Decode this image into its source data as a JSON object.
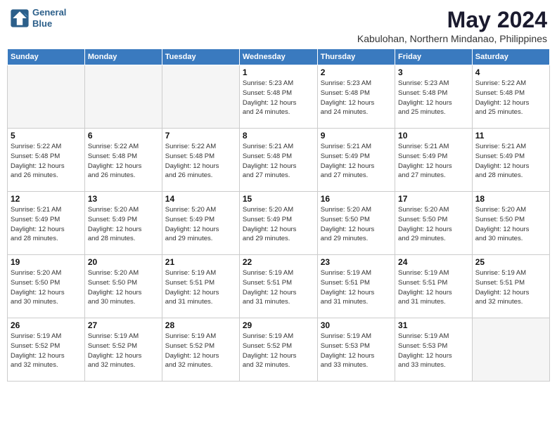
{
  "header": {
    "logo_line1": "General",
    "logo_line2": "Blue",
    "month": "May 2024",
    "location": "Kabulohan, Northern Mindanao, Philippines"
  },
  "weekdays": [
    "Sunday",
    "Monday",
    "Tuesday",
    "Wednesday",
    "Thursday",
    "Friday",
    "Saturday"
  ],
  "weeks": [
    [
      {
        "day": "",
        "info": ""
      },
      {
        "day": "",
        "info": ""
      },
      {
        "day": "",
        "info": ""
      },
      {
        "day": "1",
        "info": "Sunrise: 5:23 AM\nSunset: 5:48 PM\nDaylight: 12 hours\nand 24 minutes."
      },
      {
        "day": "2",
        "info": "Sunrise: 5:23 AM\nSunset: 5:48 PM\nDaylight: 12 hours\nand 24 minutes."
      },
      {
        "day": "3",
        "info": "Sunrise: 5:23 AM\nSunset: 5:48 PM\nDaylight: 12 hours\nand 25 minutes."
      },
      {
        "day": "4",
        "info": "Sunrise: 5:22 AM\nSunset: 5:48 PM\nDaylight: 12 hours\nand 25 minutes."
      }
    ],
    [
      {
        "day": "5",
        "info": "Sunrise: 5:22 AM\nSunset: 5:48 PM\nDaylight: 12 hours\nand 26 minutes."
      },
      {
        "day": "6",
        "info": "Sunrise: 5:22 AM\nSunset: 5:48 PM\nDaylight: 12 hours\nand 26 minutes."
      },
      {
        "day": "7",
        "info": "Sunrise: 5:22 AM\nSunset: 5:48 PM\nDaylight: 12 hours\nand 26 minutes."
      },
      {
        "day": "8",
        "info": "Sunrise: 5:21 AM\nSunset: 5:48 PM\nDaylight: 12 hours\nand 27 minutes."
      },
      {
        "day": "9",
        "info": "Sunrise: 5:21 AM\nSunset: 5:49 PM\nDaylight: 12 hours\nand 27 minutes."
      },
      {
        "day": "10",
        "info": "Sunrise: 5:21 AM\nSunset: 5:49 PM\nDaylight: 12 hours\nand 27 minutes."
      },
      {
        "day": "11",
        "info": "Sunrise: 5:21 AM\nSunset: 5:49 PM\nDaylight: 12 hours\nand 28 minutes."
      }
    ],
    [
      {
        "day": "12",
        "info": "Sunrise: 5:21 AM\nSunset: 5:49 PM\nDaylight: 12 hours\nand 28 minutes."
      },
      {
        "day": "13",
        "info": "Sunrise: 5:20 AM\nSunset: 5:49 PM\nDaylight: 12 hours\nand 28 minutes."
      },
      {
        "day": "14",
        "info": "Sunrise: 5:20 AM\nSunset: 5:49 PM\nDaylight: 12 hours\nand 29 minutes."
      },
      {
        "day": "15",
        "info": "Sunrise: 5:20 AM\nSunset: 5:49 PM\nDaylight: 12 hours\nand 29 minutes."
      },
      {
        "day": "16",
        "info": "Sunrise: 5:20 AM\nSunset: 5:50 PM\nDaylight: 12 hours\nand 29 minutes."
      },
      {
        "day": "17",
        "info": "Sunrise: 5:20 AM\nSunset: 5:50 PM\nDaylight: 12 hours\nand 29 minutes."
      },
      {
        "day": "18",
        "info": "Sunrise: 5:20 AM\nSunset: 5:50 PM\nDaylight: 12 hours\nand 30 minutes."
      }
    ],
    [
      {
        "day": "19",
        "info": "Sunrise: 5:20 AM\nSunset: 5:50 PM\nDaylight: 12 hours\nand 30 minutes."
      },
      {
        "day": "20",
        "info": "Sunrise: 5:20 AM\nSunset: 5:50 PM\nDaylight: 12 hours\nand 30 minutes."
      },
      {
        "day": "21",
        "info": "Sunrise: 5:19 AM\nSunset: 5:51 PM\nDaylight: 12 hours\nand 31 minutes."
      },
      {
        "day": "22",
        "info": "Sunrise: 5:19 AM\nSunset: 5:51 PM\nDaylight: 12 hours\nand 31 minutes."
      },
      {
        "day": "23",
        "info": "Sunrise: 5:19 AM\nSunset: 5:51 PM\nDaylight: 12 hours\nand 31 minutes."
      },
      {
        "day": "24",
        "info": "Sunrise: 5:19 AM\nSunset: 5:51 PM\nDaylight: 12 hours\nand 31 minutes."
      },
      {
        "day": "25",
        "info": "Sunrise: 5:19 AM\nSunset: 5:51 PM\nDaylight: 12 hours\nand 32 minutes."
      }
    ],
    [
      {
        "day": "26",
        "info": "Sunrise: 5:19 AM\nSunset: 5:52 PM\nDaylight: 12 hours\nand 32 minutes."
      },
      {
        "day": "27",
        "info": "Sunrise: 5:19 AM\nSunset: 5:52 PM\nDaylight: 12 hours\nand 32 minutes."
      },
      {
        "day": "28",
        "info": "Sunrise: 5:19 AM\nSunset: 5:52 PM\nDaylight: 12 hours\nand 32 minutes."
      },
      {
        "day": "29",
        "info": "Sunrise: 5:19 AM\nSunset: 5:52 PM\nDaylight: 12 hours\nand 32 minutes."
      },
      {
        "day": "30",
        "info": "Sunrise: 5:19 AM\nSunset: 5:53 PM\nDaylight: 12 hours\nand 33 minutes."
      },
      {
        "day": "31",
        "info": "Sunrise: 5:19 AM\nSunset: 5:53 PM\nDaylight: 12 hours\nand 33 minutes."
      },
      {
        "day": "",
        "info": ""
      }
    ]
  ]
}
